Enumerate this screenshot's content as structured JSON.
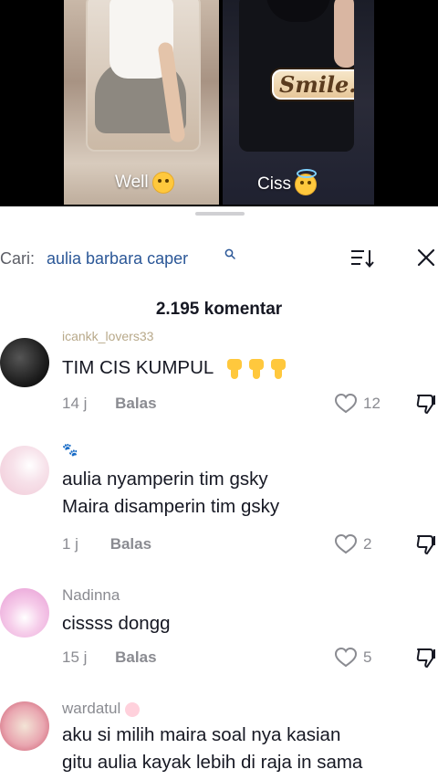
{
  "video": {
    "left_caption": "Well",
    "right_caption": "Ciss",
    "overlay_text": "Smile."
  },
  "search": {
    "prefix": "Cari:",
    "query": "aulia barbara caper",
    "icons": [
      "search-icon",
      "sort-icon",
      "close-icon"
    ]
  },
  "header": {
    "comment_count": "2.195 komentar"
  },
  "comments": [
    {
      "username": "icankk_lovers33",
      "text": "TIM CIS KUMPUL",
      "time": "14 j",
      "reply_label": "Balas",
      "likes": "12",
      "emoji": "point-down x3"
    },
    {
      "username": "",
      "text_line1": "aulia nyamperin tim gsky",
      "text_line2": "Maira disamperin tim gsky",
      "time": "1 j",
      "reply_label": "Balas",
      "likes": "2"
    },
    {
      "username": "Nadinna",
      "text": "cissss dongg",
      "time": "15 j",
      "reply_label": "Balas",
      "likes": "5"
    },
    {
      "username": "wardatul",
      "text_line1": "aku si milih maira soal nya kasian",
      "text_line2": "gitu aulia kayak lebih di raja in sama"
    }
  ],
  "colors": {
    "link_blue": "#2b5797",
    "muted_gray": "#8a8b91",
    "text": "#161823"
  }
}
